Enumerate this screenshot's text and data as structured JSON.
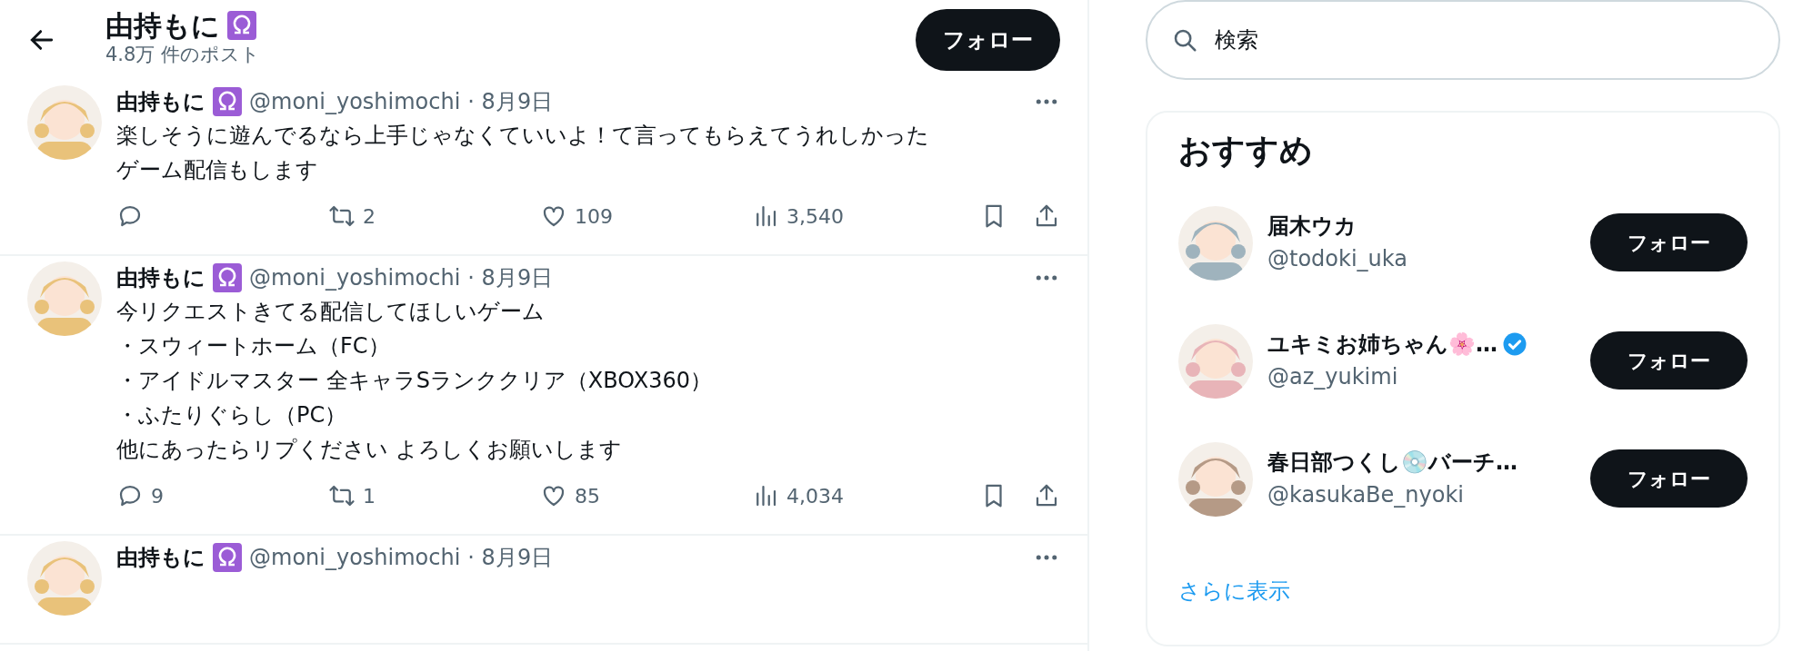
{
  "header": {
    "title": "由持もに",
    "post_count": "4.8万 件のポスト",
    "follow_button": "フォロー"
  },
  "tweets": [
    {
      "name": "由持もに",
      "handle": "@moni_yoshimochi",
      "date": "· 8月9日",
      "lines": [
        "楽しそうに遊んでるなら上手じゃなくていいよ！て言ってもらえてうれしかった",
        "ゲーム配信もします"
      ],
      "retweets": "2",
      "likes": "109",
      "views": "3,540"
    },
    {
      "name": "由持もに",
      "handle": "@moni_yoshimochi",
      "date": "· 8月9日",
      "lines": [
        "今リクエストきてる配信してほしいゲーム",
        "・スウィートホーム（FC）",
        "・アイドルマスター 全キャラSランククリア（XBOX360）",
        "・ふたりぐらし（PC）",
        "他にあったらリプください よろしくお願いします"
      ],
      "replies": "9",
      "retweets": "1",
      "likes": "85",
      "views": "4,034"
    },
    {
      "name": "由持もに",
      "handle": "@moni_yoshimochi",
      "date": "· 8月9日"
    }
  ],
  "search": {
    "placeholder": "検索"
  },
  "recommendations": {
    "title": "おすすめ",
    "users": [
      {
        "name": "届木ウカ",
        "handle": "@todoki_uka",
        "verified": false,
        "button": "フォロー",
        "color": "#9fb3bd"
      },
      {
        "name": "ユキミお姉ちゃん🌸…",
        "handle": "@az_yukimi",
        "verified": true,
        "button": "フォロー",
        "color": "#e8b4b8"
      },
      {
        "name": "春日部つくし💿バーチ…",
        "handle": "@kasukaBe_nyoki",
        "verified": false,
        "button": "フォロー",
        "color": "#b59a86"
      }
    ],
    "more": "さらに表示"
  }
}
